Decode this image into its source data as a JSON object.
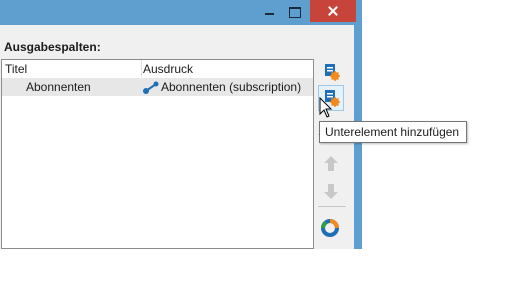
{
  "section_label": "Ausgabespalten:",
  "columns": {
    "title": "Titel",
    "expression": "Ausdruck"
  },
  "rows": [
    {
      "title": "Abonnenten",
      "expression": "Abonnenten (subscription)"
    }
  ],
  "toolbar": {
    "add_icon": "add-element-icon",
    "add_sub_icon": "add-subelement-icon",
    "up_icon": "arrow-up-icon",
    "down_icon": "arrow-down-icon",
    "settings_icon": "settings-icon"
  },
  "tooltip": "Unterelement hinzufügen",
  "colors": {
    "window_frame": "#5f9fcf",
    "close_button": "#c7443b",
    "accent_orange": "#f08a1c",
    "icon_blue": "#1e6fb5"
  }
}
